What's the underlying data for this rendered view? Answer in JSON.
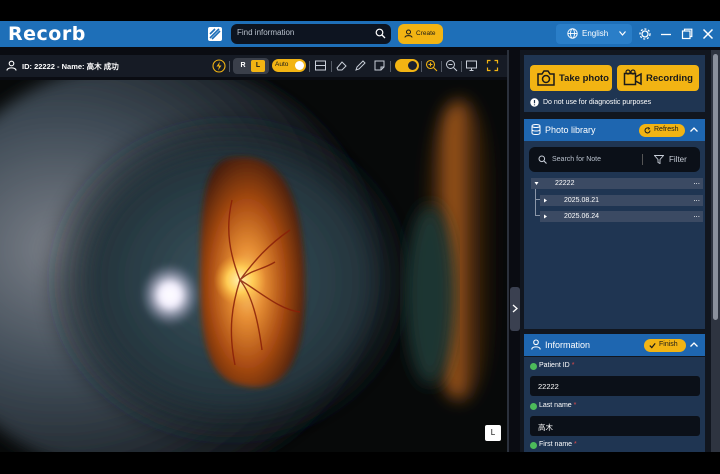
{
  "app": {
    "logo": "Recorb"
  },
  "search": {
    "placeholder": "Find information"
  },
  "create_label": "Create",
  "language": "English",
  "patient_header": "ID: 22222 - Name: 高木 成功",
  "eye": {
    "right": "R",
    "left": "L",
    "auto": "Auto",
    "tag": "L"
  },
  "capture": {
    "photo_label": "Take photo",
    "record_label": "Recording",
    "warning": "Do not use for diagnostic purposes"
  },
  "library": {
    "title": "Photo library",
    "refresh": "Refresh",
    "search_placeholder": "Search for Note",
    "filter": "Filter",
    "tree": [
      {
        "label": "22222",
        "level": 0
      },
      {
        "label": "2025.08.21",
        "level": 1
      },
      {
        "label": "2025.06.24",
        "level": 1
      }
    ]
  },
  "information": {
    "title": "Information",
    "finish": "Finish",
    "fields": [
      {
        "label": "Patient ID",
        "value": "22222"
      },
      {
        "label": "Last name",
        "value": "高木"
      },
      {
        "label": "First name",
        "value": ""
      }
    ]
  },
  "colors": {
    "accent": "#f2b413",
    "titlebar": "#1e6fb8",
    "panel": "#1f3552",
    "header": "#1e66b0"
  }
}
